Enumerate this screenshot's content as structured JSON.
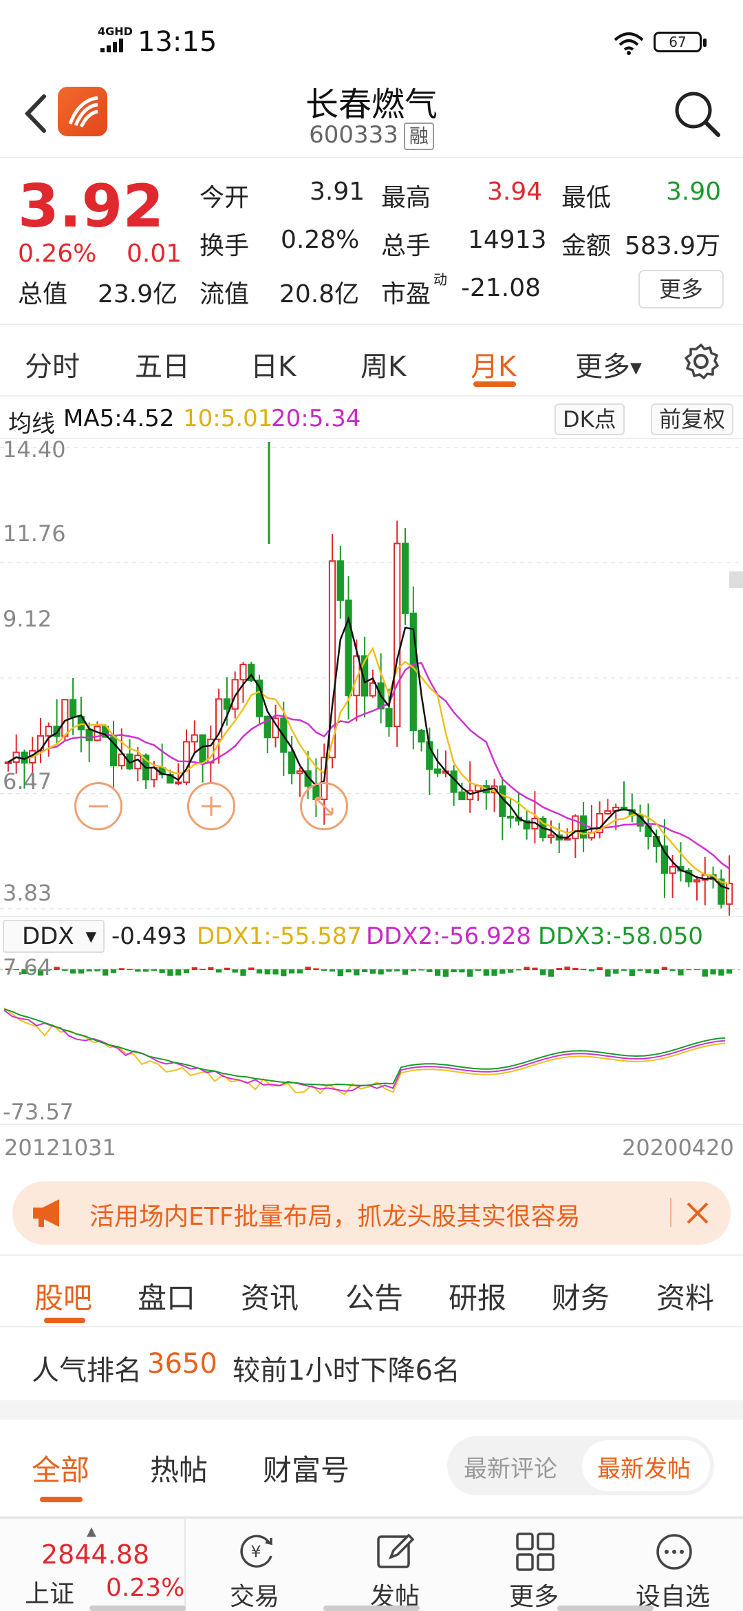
{
  "status": {
    "time": "13:15",
    "network": "4GHD",
    "battery": "67"
  },
  "header": {
    "title": "长春燃气",
    "code": "600333",
    "tag": "融"
  },
  "quote": {
    "price": "3.92",
    "change_pct": "0.26%",
    "change": "0.01",
    "open_label": "今开",
    "open": "3.91",
    "high_label": "最高",
    "high": "3.94",
    "low_label": "最低",
    "low": "3.90",
    "turnover_label": "换手",
    "turnover": "0.28%",
    "volume_label": "总手",
    "volume": "14913",
    "amount_label": "金额",
    "amount": "583.9万",
    "mktcap_label": "总值",
    "mktcap": "23.9亿",
    "float_label": "流值",
    "float": "20.8亿",
    "pe_label": "市盈",
    "pe_sup": "动",
    "pe": "-21.08",
    "more_label": "更多"
  },
  "periods": {
    "tabs": [
      "分时",
      "五日",
      "日K",
      "周K",
      "月K",
      "更多"
    ],
    "active": 4
  },
  "ma": {
    "label": "均线",
    "ma5": "MA5:4.52",
    "ma10": "10:5.01",
    "ma20": "20:5.34",
    "dk_label": "DK点",
    "adjust_label": "前复权",
    "colors": {
      "ma5": "#111111",
      "ma10": "#f0c020",
      "ma20": "#d030d0"
    }
  },
  "chart_data": {
    "type": "candlestick",
    "y_labels": [
      "14.40",
      "11.76",
      "9.12",
      "6.47",
      "3.83"
    ],
    "ylim": [
      3.83,
      14.4
    ],
    "x_start": "20121031",
    "x_end": "20200420"
  },
  "ddx": {
    "selector": "DDX",
    "value": "-0.493",
    "ddx1": "DDX1:-55.587",
    "ddx2": "DDX2:-56.928",
    "ddx3": "DDX3:-58.050",
    "top_label": "7.64",
    "bottom_label": "-73.57",
    "colors": {
      "ddx1": "#f0c020",
      "ddx2": "#d030d0",
      "ddx3": "#1a9a2a"
    }
  },
  "banner": {
    "text": "活用场内ETF批量布局，抓龙头股其实很容易"
  },
  "info_tabs": {
    "tabs": [
      "股吧",
      "盘口",
      "资讯",
      "公告",
      "研报",
      "财务",
      "资料"
    ],
    "active": 0
  },
  "rank": {
    "label": "人气排名",
    "value": "3650",
    "note": "较前1小时下降6名"
  },
  "post_tabs": {
    "tabs": [
      "全部",
      "热帖",
      "财富号"
    ],
    "active": 0,
    "sort": [
      "最新评论",
      "最新发帖"
    ],
    "sort_active": 1
  },
  "bottom_nav": {
    "index_value": "2844.88",
    "index_name": "上证",
    "index_pct": "0.23%",
    "items": [
      "交易",
      "发帖",
      "更多",
      "设自选"
    ]
  }
}
